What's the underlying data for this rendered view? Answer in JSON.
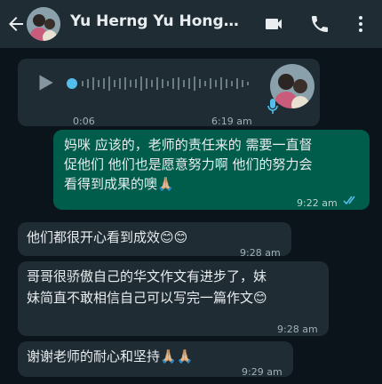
{
  "header": {
    "title": "Yu Herng Yu Hong P...",
    "icons": [
      "back-arrow-icon",
      "video-call-icon",
      "phone-icon",
      "more-vert-icon"
    ]
  },
  "voice_message": {
    "duration": "0:06",
    "time": "6:19 am"
  },
  "messages": [
    {
      "direction": "outgoing",
      "lines": [
        "妈咪 应该的，老师的责任来的 需要一直督",
        "促他们 他们也是愿意努力啊 他们的努力会",
        "看得到成果的噢🙏🏼"
      ],
      "time": "9:22 am",
      "status": "read"
    },
    {
      "direction": "incoming",
      "lines": [
        "他们都很开心看到成效😊😊"
      ],
      "time": "9:28 am"
    },
    {
      "direction": "incoming",
      "lines": [
        "哥哥很骄傲自己的华文作文有进步了，妹",
        "妹简直不敢相信自己可以写完一篇作文😊"
      ],
      "time": "9:28 am"
    },
    {
      "direction": "incoming",
      "lines": [
        "谢谢老师的耐心和坚持🙏🏼🙏🏼"
      ],
      "time": "9:29 am"
    }
  ],
  "colors": {
    "background": "#0b141a",
    "header": "#1f2c34",
    "incoming_bubble": "#1f2c34",
    "outgoing_bubble": "#005c4b",
    "read_ticks": "#53bdeb"
  }
}
